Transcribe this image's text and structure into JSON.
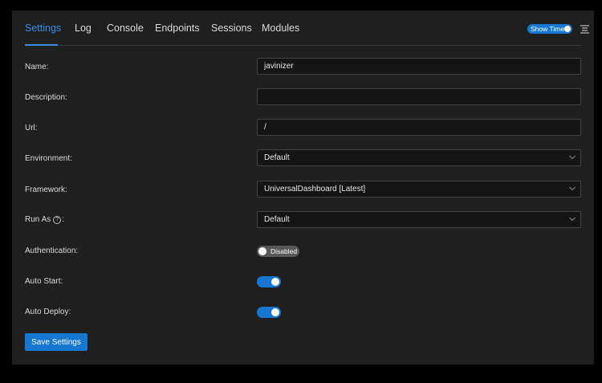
{
  "tabs": [
    {
      "label": "Settings",
      "active": true
    },
    {
      "label": "Log"
    },
    {
      "label": "Console"
    },
    {
      "label": "Endpoints"
    },
    {
      "label": "Sessions"
    },
    {
      "label": "Modules"
    }
  ],
  "header": {
    "show_time_label": "Show Time",
    "show_time_on": true,
    "menu_icon": "list-icon"
  },
  "form": {
    "name_label": "Name:",
    "name_value": "javinizer",
    "description_label": "Description:",
    "description_value": "",
    "url_label": "Url:",
    "url_value": "/",
    "environment_label": "Environment:",
    "environment_value": "Default",
    "framework_label": "Framework:",
    "framework_value": "UniversalDashboard [Latest]",
    "run_as_label": "Run As",
    "run_as_suffix": ":",
    "run_as_help_icon": "?",
    "run_as_value": "Default",
    "authentication_label": "Authentication:",
    "authentication_state": "Disabled",
    "auto_start_label": "Auto Start:",
    "auto_start_on": true,
    "auto_deploy_label": "Auto Deploy:",
    "auto_deploy_on": true
  },
  "actions": {
    "save_label": "Save Settings"
  },
  "colors": {
    "accent": "#1677d2",
    "panel": "#1f1f1f",
    "background": "#000000"
  }
}
